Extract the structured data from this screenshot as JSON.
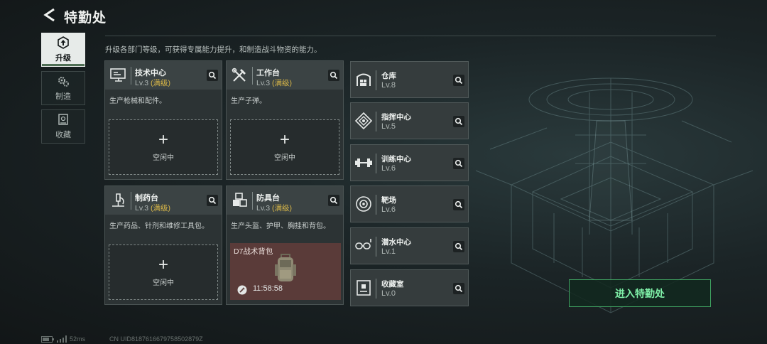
{
  "header": {
    "title": "特勤处"
  },
  "subtitle": "升级各部门等级，可获得专属能力提升，和制造战斗物资的能力。",
  "side_tabs": [
    {
      "label": "升级",
      "icon": "upgrade-icon",
      "active": true
    },
    {
      "label": "制造",
      "icon": "gears-icon",
      "active": false
    },
    {
      "label": "收藏",
      "icon": "collection-icon",
      "active": false
    }
  ],
  "cards": [
    {
      "name": "技术中心",
      "level": "Lv.3",
      "max": "(满级)",
      "desc": "生产枪械和配件。",
      "slot": {
        "plus": "+",
        "idle": "空闲中"
      }
    },
    {
      "name": "工作台",
      "level": "Lv.3",
      "max": "(满级)",
      "desc": "生产子弹。",
      "slot": {
        "plus": "+",
        "idle": "空闲中"
      }
    },
    {
      "name": "制药台",
      "level": "Lv.3",
      "max": "(满级)",
      "desc": "生产药品、针剂和维修工具包。",
      "slot": {
        "plus": "+",
        "idle": "空闲中"
      }
    },
    {
      "name": "防具台",
      "level": "Lv.3",
      "max": "(满级)",
      "desc": "生产头盔、护甲、胸挂和背包。",
      "production": {
        "item": "D7战术背包",
        "timer": "11:58:58"
      }
    }
  ],
  "facilities": [
    {
      "name": "仓库",
      "level": "Lv.8",
      "icon": "warehouse-icon"
    },
    {
      "name": "指挥中心",
      "level": "Lv.5",
      "icon": "command-center-icon"
    },
    {
      "name": "训练中心",
      "level": "Lv.6",
      "icon": "dumbbell-icon"
    },
    {
      "name": "靶场",
      "level": "Lv.6",
      "icon": "target-icon"
    },
    {
      "name": "潜水中心",
      "level": "Lv.1",
      "icon": "diving-mask-icon"
    },
    {
      "name": "收藏室",
      "level": "Lv.0",
      "icon": "collection-room-icon"
    }
  ],
  "enter_button": "进入特勤处",
  "status": {
    "ping": "52ms",
    "uid": "CN UID8187616679758502879Z"
  },
  "colors": {
    "accent_green": "#7ff0a8",
    "max_level": "#d9b748"
  }
}
